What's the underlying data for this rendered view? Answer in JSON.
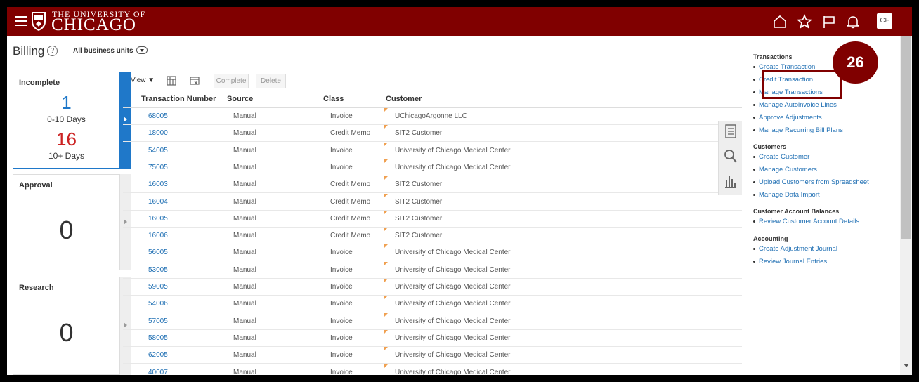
{
  "header": {
    "logo_top": "THE UNIVERSITY OF",
    "logo_bottom": "CHICAGO",
    "avatar": "CF",
    "icons": [
      "home-icon",
      "star-icon",
      "flag-icon",
      "bell-icon"
    ]
  },
  "page": {
    "title": "Billing",
    "help": "?",
    "business_unit": "All business units"
  },
  "tiles": {
    "incomplete": {
      "title": "Incomplete",
      "count1": "1",
      "label1": "0-10 Days",
      "count2": "16",
      "label2": "10+ Days"
    },
    "approval": {
      "title": "Approval",
      "count": "0"
    },
    "research": {
      "title": "Research",
      "count": "0"
    }
  },
  "toolbar": {
    "view": "View",
    "complete": "Complete",
    "delete": "Delete"
  },
  "table": {
    "columns": [
      "Transaction Number",
      "Source",
      "Class",
      "Customer"
    ],
    "rows": [
      [
        "68005",
        "Manual",
        "Invoice",
        "UChicagoArgonne LLC"
      ],
      [
        "18000",
        "Manual",
        "Credit Memo",
        "SIT2 Customer"
      ],
      [
        "54005",
        "Manual",
        "Invoice",
        "University of Chicago Medical Center"
      ],
      [
        "75005",
        "Manual",
        "Invoice",
        "University of Chicago Medical Center"
      ],
      [
        "16003",
        "Manual",
        "Credit Memo",
        "SIT2 Customer"
      ],
      [
        "16004",
        "Manual",
        "Credit Memo",
        "SIT2 Customer"
      ],
      [
        "16005",
        "Manual",
        "Credit Memo",
        "SIT2 Customer"
      ],
      [
        "16006",
        "Manual",
        "Credit Memo",
        "SIT2 Customer"
      ],
      [
        "56005",
        "Manual",
        "Invoice",
        "University of Chicago Medical Center"
      ],
      [
        "53005",
        "Manual",
        "Invoice",
        "University of Chicago Medical Center"
      ],
      [
        "59005",
        "Manual",
        "Invoice",
        "University of Chicago Medical Center"
      ],
      [
        "54006",
        "Manual",
        "Invoice",
        "University of Chicago Medical Center"
      ],
      [
        "57005",
        "Manual",
        "Invoice",
        "University of Chicago Medical Center"
      ],
      [
        "58005",
        "Manual",
        "Invoice",
        "University of Chicago Medical Center"
      ],
      [
        "62005",
        "Manual",
        "Invoice",
        "University of Chicago Medical Center"
      ],
      [
        "40007",
        "Manual",
        "Invoice",
        "University of Chicago Medical Center"
      ]
    ]
  },
  "tasks": {
    "transactions": {
      "heading": "Transactions",
      "links": [
        "Create Transaction",
        "Credit Transaction",
        "Manage Transactions",
        "Manage Autoinvoice Lines",
        "Approve Adjustments",
        "Manage Recurring Bill Plans"
      ]
    },
    "customers": {
      "heading": "Customers",
      "links": [
        "Create Customer",
        "Manage Customers",
        "Upload Customers from Spreadsheet",
        "Manage Data Import"
      ]
    },
    "balances": {
      "heading": "Customer Account Balances",
      "links": [
        "Review Customer Account Details"
      ]
    },
    "accounting": {
      "heading": "Accounting",
      "links": [
        "Create Adjustment Journal",
        "Review Journal Entries"
      ]
    }
  },
  "callout": {
    "step": "26"
  },
  "colors": {
    "brand": "#800000",
    "accent": "#1f78c9",
    "link": "#1f6fb3",
    "red_count": "#cc2222"
  }
}
